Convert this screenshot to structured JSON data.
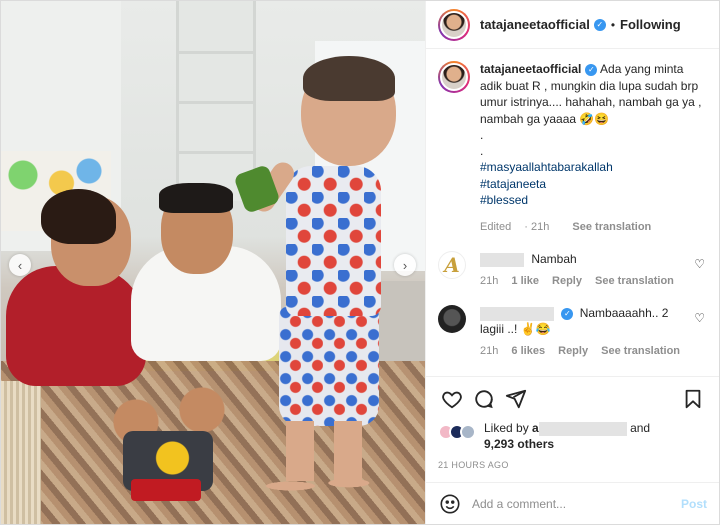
{
  "post": {
    "author": "tatajaneetaofficial",
    "follow_status": "Following",
    "separator": "•",
    "caption_text": "Ada yang minta adik buat R , mungkin dia lupa sudah brp umur istrinya.... hahahah, nambah ga ya , nambah ga yaaaa 🤣😆",
    "caption_dots": [
      ".",
      "."
    ],
    "hashtags": [
      "#masyaallahtabarakallah",
      "#tatajaneeta",
      "#blessed"
    ],
    "caption_edited": "Edited",
    "caption_time": "21h",
    "see_translation": "See translation"
  },
  "comments": [
    {
      "avatar_letter": "A",
      "text": "Nambah",
      "time": "21h",
      "likes": "1 like",
      "reply": "Reply",
      "see_translation": "See translation"
    },
    {
      "text": "Nambaaaahh.. 2 lagiii ..! ✌️😂",
      "time": "21h",
      "likes": "6 likes",
      "reply": "Reply",
      "see_translation": "See translation"
    }
  ],
  "likes": {
    "liked_by": "Liked by",
    "name_prefix": "a",
    "and": "and",
    "others": "9,293 others"
  },
  "timestamp": "21 HOURS AGO",
  "add_comment": {
    "placeholder": "Add a comment...",
    "post_label": "Post"
  },
  "icons": {
    "prev": "chevron-left-icon",
    "next": "chevron-right-icon",
    "heart": "heart-icon",
    "comment": "comment-icon",
    "share": "share-icon",
    "save": "bookmark-icon",
    "emoji": "emoji-icon"
  },
  "colors": {
    "verified": "#3897f0",
    "hashtag": "#00376b",
    "muted": "#8e8e8e",
    "post_disabled": "#b2dffc"
  }
}
